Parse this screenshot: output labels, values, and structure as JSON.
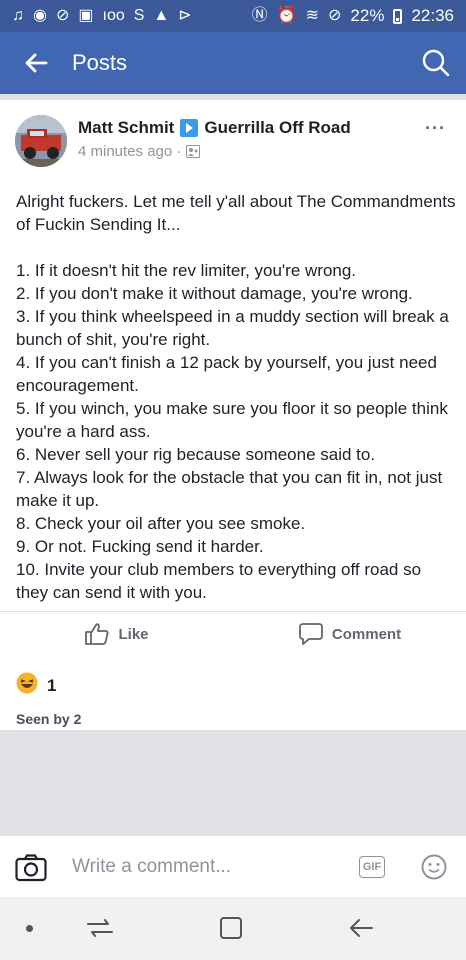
{
  "status_bar": {
    "battery": "22%",
    "time": "22:36",
    "notification_icons": [
      "music-icon",
      "camera-icon",
      "phone-icon",
      "tv-icon",
      "loo-icon",
      "s-icon",
      "alert-icon",
      "play-icon"
    ],
    "notification_texts": [
      "♫",
      "◉",
      "⊘",
      "▣",
      "ıoo",
      "S",
      "▲",
      "⊳"
    ]
  },
  "app_bar": {
    "title": "Posts"
  },
  "post": {
    "author": "Matt Schmit",
    "group": "Guerrilla Off Road",
    "timestamp": "4 minutes ago · ",
    "more": "···",
    "intro": "Alright fuckers. Let me tell y'all about The Commandments of Fuckin Sending It...",
    "commandments": [
      "1. If it doesn't hit the rev limiter, you're wrong.",
      "2. If you don't make it without damage, you're wrong.",
      "3. If you think wheelspeed in a muddy section will break a bunch of shit, you're right.",
      "4. If you can't finish a 12 pack by yourself, you just need encouragement.",
      "5. If you winch, you make sure you floor it so people think you're a hard ass.",
      "6. Never sell your rig because someone said to.",
      "7. Always look for the obstacle that you can fit in, not just make it up.",
      "8. Check your oil after you see smoke.",
      "9. Or not. Fucking send it harder.",
      "10. Invite your club members to everything off road so they can send it with you."
    ],
    "like_label": "Like",
    "comment_label": "Comment"
  },
  "reactions": {
    "count": "1",
    "seen_by": "Seen by 2"
  },
  "composer": {
    "placeholder": "Write a comment...",
    "gif_label": "GIF"
  },
  "colors": {
    "brand": "#4267b2",
    "status": "#3b5998",
    "reaction": "#f7b125"
  }
}
